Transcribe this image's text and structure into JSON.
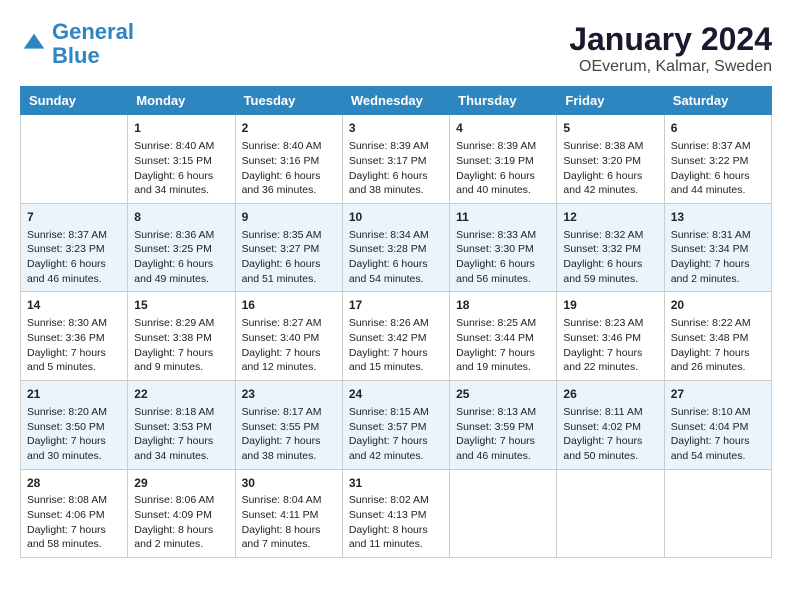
{
  "logo": {
    "line1": "General",
    "line2": "Blue"
  },
  "title": "January 2024",
  "subtitle": "OEverum, Kalmar, Sweden",
  "days_of_week": [
    "Sunday",
    "Monday",
    "Tuesday",
    "Wednesday",
    "Thursday",
    "Friday",
    "Saturday"
  ],
  "weeks": [
    [
      {
        "day": "",
        "sunrise": "",
        "sunset": "",
        "daylight": ""
      },
      {
        "day": "1",
        "sunrise": "Sunrise: 8:40 AM",
        "sunset": "Sunset: 3:15 PM",
        "daylight": "Daylight: 6 hours and 34 minutes."
      },
      {
        "day": "2",
        "sunrise": "Sunrise: 8:40 AM",
        "sunset": "Sunset: 3:16 PM",
        "daylight": "Daylight: 6 hours and 36 minutes."
      },
      {
        "day": "3",
        "sunrise": "Sunrise: 8:39 AM",
        "sunset": "Sunset: 3:17 PM",
        "daylight": "Daylight: 6 hours and 38 minutes."
      },
      {
        "day": "4",
        "sunrise": "Sunrise: 8:39 AM",
        "sunset": "Sunset: 3:19 PM",
        "daylight": "Daylight: 6 hours and 40 minutes."
      },
      {
        "day": "5",
        "sunrise": "Sunrise: 8:38 AM",
        "sunset": "Sunset: 3:20 PM",
        "daylight": "Daylight: 6 hours and 42 minutes."
      },
      {
        "day": "6",
        "sunrise": "Sunrise: 8:37 AM",
        "sunset": "Sunset: 3:22 PM",
        "daylight": "Daylight: 6 hours and 44 minutes."
      }
    ],
    [
      {
        "day": "7",
        "sunrise": "Sunrise: 8:37 AM",
        "sunset": "Sunset: 3:23 PM",
        "daylight": "Daylight: 6 hours and 46 minutes."
      },
      {
        "day": "8",
        "sunrise": "Sunrise: 8:36 AM",
        "sunset": "Sunset: 3:25 PM",
        "daylight": "Daylight: 6 hours and 49 minutes."
      },
      {
        "day": "9",
        "sunrise": "Sunrise: 8:35 AM",
        "sunset": "Sunset: 3:27 PM",
        "daylight": "Daylight: 6 hours and 51 minutes."
      },
      {
        "day": "10",
        "sunrise": "Sunrise: 8:34 AM",
        "sunset": "Sunset: 3:28 PM",
        "daylight": "Daylight: 6 hours and 54 minutes."
      },
      {
        "day": "11",
        "sunrise": "Sunrise: 8:33 AM",
        "sunset": "Sunset: 3:30 PM",
        "daylight": "Daylight: 6 hours and 56 minutes."
      },
      {
        "day": "12",
        "sunrise": "Sunrise: 8:32 AM",
        "sunset": "Sunset: 3:32 PM",
        "daylight": "Daylight: 6 hours and 59 minutes."
      },
      {
        "day": "13",
        "sunrise": "Sunrise: 8:31 AM",
        "sunset": "Sunset: 3:34 PM",
        "daylight": "Daylight: 7 hours and 2 minutes."
      }
    ],
    [
      {
        "day": "14",
        "sunrise": "Sunrise: 8:30 AM",
        "sunset": "Sunset: 3:36 PM",
        "daylight": "Daylight: 7 hours and 5 minutes."
      },
      {
        "day": "15",
        "sunrise": "Sunrise: 8:29 AM",
        "sunset": "Sunset: 3:38 PM",
        "daylight": "Daylight: 7 hours and 9 minutes."
      },
      {
        "day": "16",
        "sunrise": "Sunrise: 8:27 AM",
        "sunset": "Sunset: 3:40 PM",
        "daylight": "Daylight: 7 hours and 12 minutes."
      },
      {
        "day": "17",
        "sunrise": "Sunrise: 8:26 AM",
        "sunset": "Sunset: 3:42 PM",
        "daylight": "Daylight: 7 hours and 15 minutes."
      },
      {
        "day": "18",
        "sunrise": "Sunrise: 8:25 AM",
        "sunset": "Sunset: 3:44 PM",
        "daylight": "Daylight: 7 hours and 19 minutes."
      },
      {
        "day": "19",
        "sunrise": "Sunrise: 8:23 AM",
        "sunset": "Sunset: 3:46 PM",
        "daylight": "Daylight: 7 hours and 22 minutes."
      },
      {
        "day": "20",
        "sunrise": "Sunrise: 8:22 AM",
        "sunset": "Sunset: 3:48 PM",
        "daylight": "Daylight: 7 hours and 26 minutes."
      }
    ],
    [
      {
        "day": "21",
        "sunrise": "Sunrise: 8:20 AM",
        "sunset": "Sunset: 3:50 PM",
        "daylight": "Daylight: 7 hours and 30 minutes."
      },
      {
        "day": "22",
        "sunrise": "Sunrise: 8:18 AM",
        "sunset": "Sunset: 3:53 PM",
        "daylight": "Daylight: 7 hours and 34 minutes."
      },
      {
        "day": "23",
        "sunrise": "Sunrise: 8:17 AM",
        "sunset": "Sunset: 3:55 PM",
        "daylight": "Daylight: 7 hours and 38 minutes."
      },
      {
        "day": "24",
        "sunrise": "Sunrise: 8:15 AM",
        "sunset": "Sunset: 3:57 PM",
        "daylight": "Daylight: 7 hours and 42 minutes."
      },
      {
        "day": "25",
        "sunrise": "Sunrise: 8:13 AM",
        "sunset": "Sunset: 3:59 PM",
        "daylight": "Daylight: 7 hours and 46 minutes."
      },
      {
        "day": "26",
        "sunrise": "Sunrise: 8:11 AM",
        "sunset": "Sunset: 4:02 PM",
        "daylight": "Daylight: 7 hours and 50 minutes."
      },
      {
        "day": "27",
        "sunrise": "Sunrise: 8:10 AM",
        "sunset": "Sunset: 4:04 PM",
        "daylight": "Daylight: 7 hours and 54 minutes."
      }
    ],
    [
      {
        "day": "28",
        "sunrise": "Sunrise: 8:08 AM",
        "sunset": "Sunset: 4:06 PM",
        "daylight": "Daylight: 7 hours and 58 minutes."
      },
      {
        "day": "29",
        "sunrise": "Sunrise: 8:06 AM",
        "sunset": "Sunset: 4:09 PM",
        "daylight": "Daylight: 8 hours and 2 minutes."
      },
      {
        "day": "30",
        "sunrise": "Sunrise: 8:04 AM",
        "sunset": "Sunset: 4:11 PM",
        "daylight": "Daylight: 8 hours and 7 minutes."
      },
      {
        "day": "31",
        "sunrise": "Sunrise: 8:02 AM",
        "sunset": "Sunset: 4:13 PM",
        "daylight": "Daylight: 8 hours and 11 minutes."
      },
      {
        "day": "",
        "sunrise": "",
        "sunset": "",
        "daylight": ""
      },
      {
        "day": "",
        "sunrise": "",
        "sunset": "",
        "daylight": ""
      },
      {
        "day": "",
        "sunrise": "",
        "sunset": "",
        "daylight": ""
      }
    ]
  ]
}
